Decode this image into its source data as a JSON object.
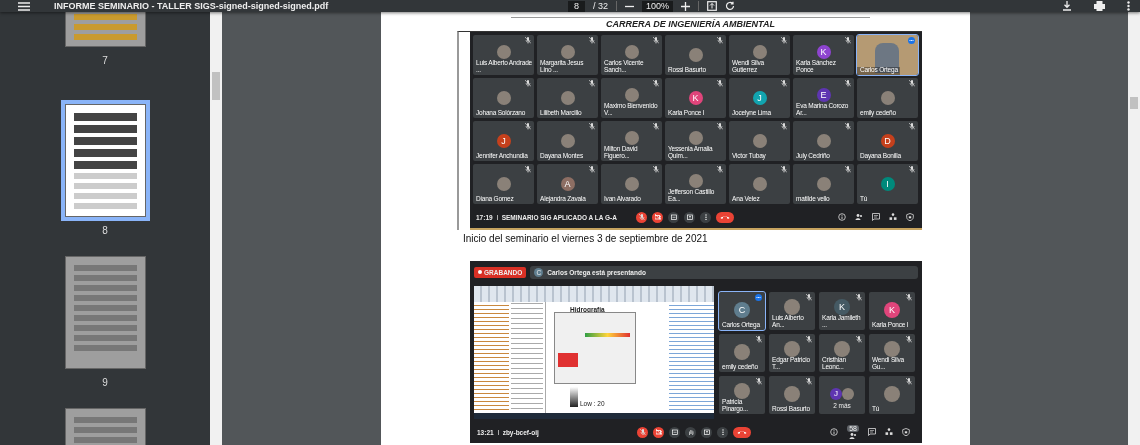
{
  "toolbar": {
    "title": "INFORME SEMINARIO - TALLER SIGS-signed-signed-signed.pdf",
    "page": "8",
    "page_total": "/ 32",
    "zoom": "100%"
  },
  "sidebar": {
    "pages": [
      {
        "label": "7",
        "selected": false,
        "kind": "partial"
      },
      {
        "label": "8",
        "selected": true,
        "kind": "meeting"
      },
      {
        "label": "9",
        "selected": false,
        "kind": "table"
      },
      {
        "selected": false,
        "kind": "hidden"
      }
    ]
  },
  "document": {
    "heading": "CARRERA DE INGENIERÍA AMBIENTAL",
    "meeting_1": {
      "tiles": [
        {
          "name": "Luis Alberto Andrade ...",
          "kind": "photo",
          "muted": true,
          "selected": false
        },
        {
          "name": "Margarita Jesus Lino ...",
          "kind": "photo",
          "muted": true,
          "selected": false
        },
        {
          "name": "Carlos Vicente Sanch...",
          "kind": "photo",
          "muted": true,
          "selected": false
        },
        {
          "name": "Rossi Basurto",
          "kind": "photo",
          "muted": true,
          "selected": false
        },
        {
          "name": "Wendi Silva Gutierrez",
          "kind": "photo",
          "muted": true,
          "selected": false
        },
        {
          "name": "Karla Sánchez Ponce",
          "kind": "letter",
          "letter": "K",
          "color": "#8e44d0",
          "muted": true,
          "selected": false
        },
        {
          "name": "Carlos Ortega",
          "kind": "video",
          "muted": false,
          "selected": true
        },
        {
          "name": "Johana Solórzano",
          "kind": "photo",
          "muted": true,
          "selected": false
        },
        {
          "name": "Lilibeth Marcillo",
          "kind": "photo",
          "muted": true,
          "selected": false
        },
        {
          "name": "Maximo Bienvenido V...",
          "kind": "photo",
          "muted": true,
          "selected": false
        },
        {
          "name": "Karla Ponce I",
          "kind": "letter",
          "letter": "K",
          "color": "#e0457b",
          "muted": true,
          "selected": false
        },
        {
          "name": "Jocelyne Lima",
          "kind": "letter",
          "letter": "J",
          "color": "#12a4af",
          "muted": true,
          "selected": false
        },
        {
          "name": "Eva Marina Corozo Ar...",
          "kind": "letter",
          "letter": "E",
          "color": "#5e35b1",
          "muted": true,
          "selected": false
        },
        {
          "name": "emily cedeño",
          "kind": "photo",
          "muted": true,
          "selected": false
        },
        {
          "name": "Jennifer Anchundia",
          "kind": "letter",
          "letter": "J",
          "color": "#c5401c",
          "muted": true,
          "selected": false
        },
        {
          "name": "Dayana Montes",
          "kind": "photo",
          "muted": true,
          "selected": false
        },
        {
          "name": "Milton David Figuero...",
          "kind": "photo",
          "muted": true,
          "selected": false
        },
        {
          "name": "Yessenia Amalia Quim...",
          "kind": "photo",
          "muted": true,
          "selected": false
        },
        {
          "name": "Victor Tubay",
          "kind": "photo",
          "muted": true,
          "selected": false
        },
        {
          "name": "July Cedriño",
          "kind": "photo",
          "muted": true,
          "selected": false
        },
        {
          "name": "Dayana Bonilla",
          "kind": "letter",
          "letter": "D",
          "color": "#c5401c",
          "muted": true,
          "selected": false
        },
        {
          "name": "Diana Gomez",
          "kind": "photo",
          "muted": true,
          "selected": false
        },
        {
          "name": "Alejandra Zavala",
          "kind": "letter",
          "letter": "A",
          "color": "#8d6e63",
          "muted": true,
          "selected": false
        },
        {
          "name": "Ivan Alvarado",
          "kind": "photo",
          "muted": true,
          "selected": false
        },
        {
          "name": "Jefferson Castillo Ea...",
          "kind": "photo",
          "muted": true,
          "selected": false
        },
        {
          "name": "Ana Velez",
          "kind": "photo",
          "muted": true,
          "selected": false
        },
        {
          "name": "matilde vello",
          "kind": "photo",
          "muted": true,
          "selected": false
        },
        {
          "name": "Tú",
          "kind": "letter",
          "letter": "I",
          "color": "#00897b",
          "muted": true,
          "selected": false
        }
      ],
      "time": "17:19",
      "meeting_name": "SEMINARIO SIG APLICADO A LA G-A",
      "controls": [
        {
          "kind": "mic",
          "muted": true
        },
        {
          "kind": "camera",
          "muted": true
        },
        {
          "kind": "captions",
          "muted": false
        },
        {
          "kind": "present",
          "muted": false
        },
        {
          "kind": "more",
          "muted": false
        },
        {
          "kind": "hangup"
        }
      ]
    },
    "caption": "Inicio del seminario el viernes 3 de septiembre de 2021",
    "meeting_2": {
      "recording": "GRABANDO",
      "presenter": {
        "letter": "C",
        "text": "Carlos Ortega está presentando"
      },
      "screen_share": {
        "title": "Hidrografía",
        "legend": "Low : 20"
      },
      "tiles": [
        {
          "name": "Carlos Ortega",
          "kind": "letter",
          "letter": "C",
          "color": "#5f7d8e",
          "muted": false,
          "selected": true
        },
        {
          "name": "Luis Alberto An...",
          "kind": "photo",
          "muted": true,
          "selected": false
        },
        {
          "name": "Karla Jamileth ...",
          "kind": "letter",
          "letter": "K",
          "color": "#455a64",
          "muted": true,
          "selected": false
        },
        {
          "name": "Karla Ponce I",
          "kind": "letter",
          "letter": "K",
          "color": "#e0457b",
          "muted": true,
          "selected": false
        },
        {
          "name": "emily cedeño",
          "kind": "photo",
          "muted": true,
          "selected": false
        },
        {
          "name": "Edgar Patricio T...",
          "kind": "photo",
          "muted": true,
          "selected": false
        },
        {
          "name": "Cristhian Leonc...",
          "kind": "photo",
          "muted": true,
          "selected": false
        },
        {
          "name": "Wendi Silva Gu...",
          "kind": "photo",
          "muted": true,
          "selected": false
        },
        {
          "name": "Patricia Pinargo...",
          "kind": "photo",
          "muted": true,
          "selected": false
        },
        {
          "name": "Rossi Basurto",
          "kind": "photo",
          "muted": true,
          "selected": false
        },
        {
          "name": "2 más",
          "kind": "more",
          "letter": "J",
          "color": "#5e35b1",
          "muted": false,
          "selected": false
        },
        {
          "name": "Tú",
          "kind": "photo",
          "muted": true,
          "selected": false
        }
      ],
      "time": "13:21",
      "meeting_name": "zby-bcef-oij",
      "controls": [
        {
          "kind": "mic",
          "muted": true
        },
        {
          "kind": "camera",
          "muted": true
        },
        {
          "kind": "captions",
          "muted": false
        },
        {
          "kind": "hand",
          "muted": false
        },
        {
          "kind": "present",
          "muted": false
        },
        {
          "kind": "more",
          "muted": false
        },
        {
          "kind": "hangup"
        }
      ],
      "people_count": "58"
    }
  }
}
